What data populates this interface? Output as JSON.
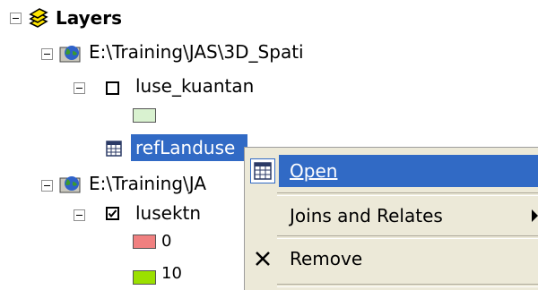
{
  "toc": {
    "root_label": "Layers",
    "frames": [
      {
        "path": "E:\\Training\\JAS\\3D_Spati",
        "layers": [
          {
            "name": "luse_kuantan",
            "checked": false,
            "legend": [
              {
                "color": "#d9f2d0",
                "label": ""
              }
            ]
          },
          {
            "name": "refLanduse",
            "selected": true
          }
        ]
      },
      {
        "path": "E:\\Training\\JA",
        "layers": [
          {
            "name": "lusektn",
            "checked": true,
            "legend": [
              {
                "color": "#f08080",
                "label": "0"
              },
              {
                "color": "#9be000",
                "label": "10"
              }
            ]
          }
        ]
      }
    ]
  },
  "context_menu": {
    "items": [
      {
        "label": "Open",
        "icon": "table-icon",
        "selected": true
      },
      {
        "label": "Joins and Relates",
        "has_submenu": true
      },
      {
        "label": "Remove",
        "icon": "remove-x-icon"
      }
    ]
  }
}
